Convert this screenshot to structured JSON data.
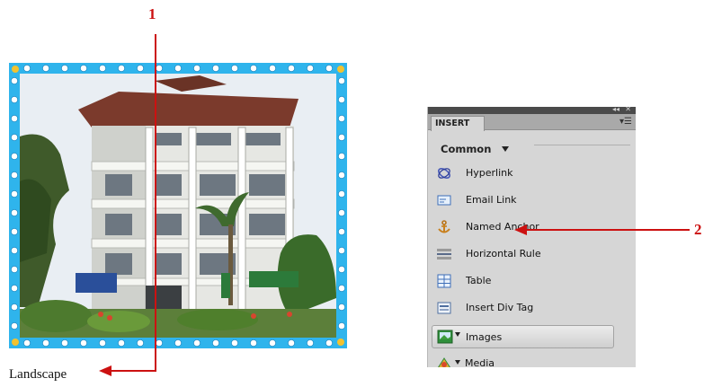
{
  "callouts": {
    "one": "1",
    "two": "2"
  },
  "caption": "Landscape",
  "colors": {
    "accent_red": "#cc1111",
    "frame_blue": "#2fb4ec",
    "panel_bg": "#d6d6d6"
  },
  "panel": {
    "tab": "INSERT",
    "category": "Common",
    "items": [
      {
        "label": "Hyperlink",
        "icon": "hyperlink-icon"
      },
      {
        "label": "Email Link",
        "icon": "email-link-icon"
      },
      {
        "label": "Named Anchor",
        "icon": "named-anchor-icon"
      },
      {
        "label": "Horizontal Rule",
        "icon": "horizontal-rule-icon"
      },
      {
        "label": "Table",
        "icon": "table-icon"
      },
      {
        "label": "Insert Div Tag",
        "icon": "div-tag-icon"
      }
    ],
    "images_label": "Images",
    "media_label": "Media"
  }
}
